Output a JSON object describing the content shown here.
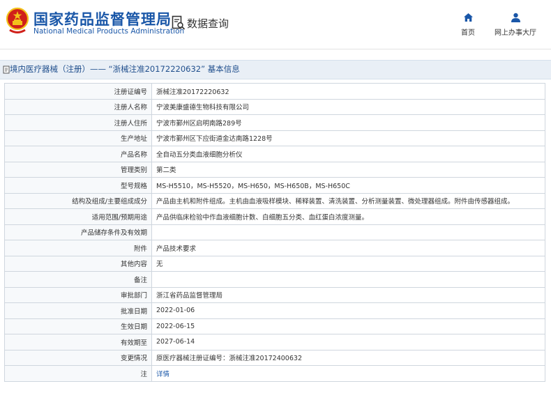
{
  "header": {
    "brand_cn": "国家药品监督管理局",
    "brand_en": "National Medical Products Administration",
    "query_title": "数据查询",
    "nav": {
      "home": "首页",
      "hall": "网上办事大厅"
    }
  },
  "page_title": "境内医疗器械（注册）——  “浙械注准20172220632”  基本信息",
  "fields": [
    {
      "label": "注册证编号",
      "value": "浙械注准20172220632"
    },
    {
      "label": "注册人名称",
      "value": "宁波美康盛德生物科技有限公司"
    },
    {
      "label": "注册人住所",
      "value": "宁波市鄞州区启明南路289号"
    },
    {
      "label": "生产地址",
      "value": "宁波市鄞州区下应街道金达南路1228号"
    },
    {
      "label": "产品名称",
      "value": "全自动五分类血液细胞分析仪"
    },
    {
      "label": "管理类别",
      "value": "第二类"
    },
    {
      "label": "型号规格",
      "value": "MS-H5510，MS-H5520，MS-H650，MS-H650B，MS-H650C"
    },
    {
      "label": "结构及组成/主要组成成分",
      "value": "产品由主机和附件组成。主机由血液吸样模块、稀释装置、清洗装置、分析测量装置、微处理器组成。附件由传感器组成。"
    },
    {
      "label": "适用范围/预期用途",
      "value": "产品供临床检验中作血液细胞计数、白细胞五分类、血红蛋白浓度测量。"
    },
    {
      "label": "产品储存条件及有效期",
      "value": ""
    },
    {
      "label": "附件",
      "value": "产品技术要求"
    },
    {
      "label": "其他内容",
      "value": "无"
    },
    {
      "label": "备注",
      "value": ""
    },
    {
      "label": "审批部门",
      "value": "浙江省药品监督管理局"
    },
    {
      "label": "批准日期",
      "value": "2022-01-06"
    },
    {
      "label": "生效日期",
      "value": "2022-06-15"
    },
    {
      "label": "有效期至",
      "value": "2027-06-14"
    },
    {
      "label": "变更情况",
      "value": "原医疗器械注册证编号：浙械注准20172400632"
    },
    {
      "label": "注",
      "value": "详情"
    }
  ],
  "colors": {
    "brand": "#1a57a8",
    "emblem_red": "#d0201a",
    "emblem_gold": "#f2c21b"
  },
  "icons": {
    "emblem": "national-emblem-icon",
    "query": "document-search-icon",
    "home": "home-icon",
    "hall": "user-icon",
    "title": "document-icon"
  }
}
